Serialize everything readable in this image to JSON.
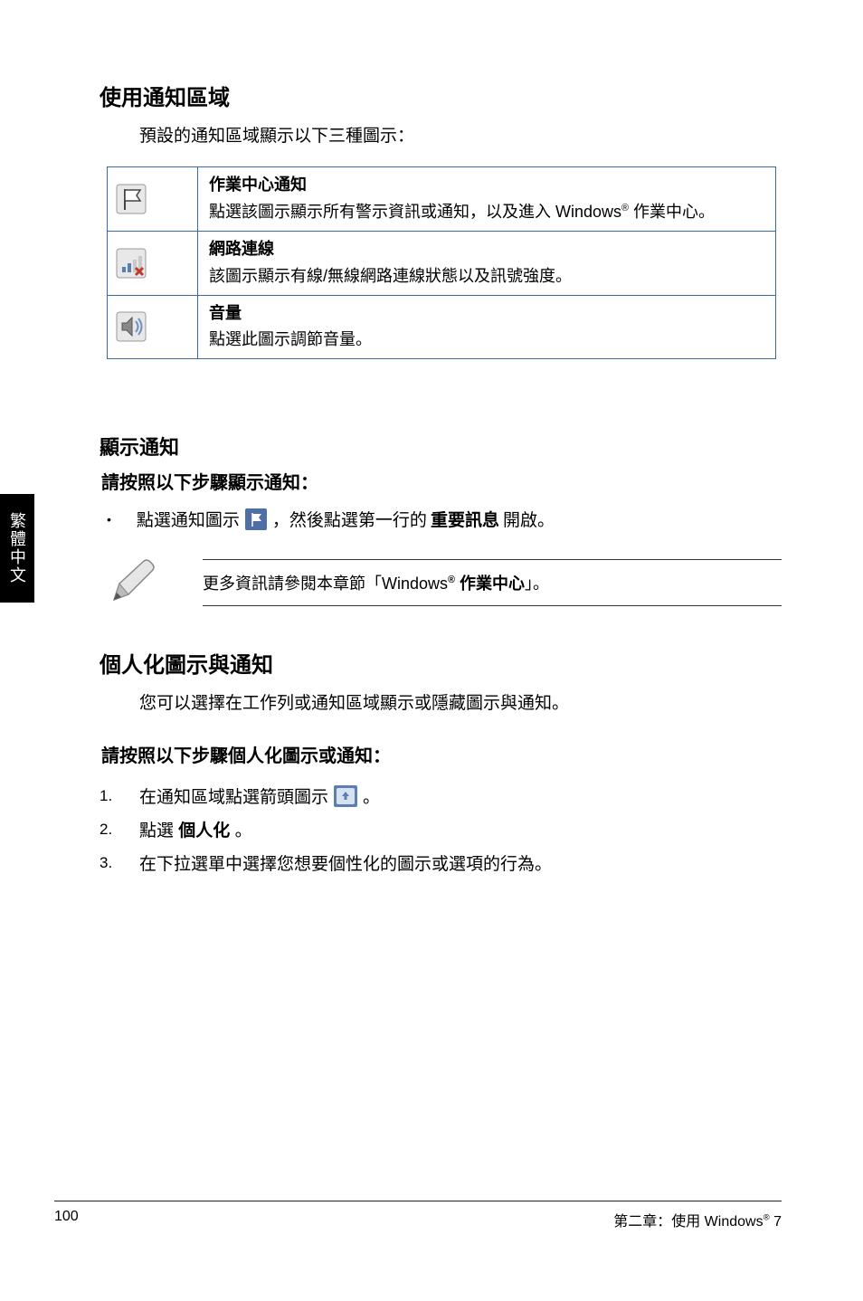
{
  "side_tab": "繁體中文",
  "section1": {
    "title": "使用通知區域",
    "intro": "預設的通知區域顯示以下三種圖示：",
    "rows": [
      {
        "title": "作業中心通知",
        "desc_pre": "點選該圖示顯示所有警示資訊或通知，以及進入 Windows",
        "desc_post": " 作業中心。"
      },
      {
        "title": "網路連線",
        "desc": "該圖示顯示有線/無線網路連線狀態以及訊號強度。"
      },
      {
        "title": "音量",
        "desc": "點選此圖示調節音量。"
      }
    ]
  },
  "section2": {
    "title": "顯示通知",
    "intro": "請按照以下步驟顯示通知：",
    "bullet_pre": "點選通知圖示",
    "bullet_mid": "，然後點選第一行的",
    "bullet_bold": " 重要訊息 ",
    "bullet_end": "開啟。",
    "note_pre": "更多資訊請參閱本章節「Windows",
    "note_bold": " 作業中心",
    "note_end": "」。"
  },
  "section3": {
    "title": "個人化圖示與通知",
    "intro": "您可以選擇在工作列或通知區域顯示或隱藏圖示與通知。",
    "steps_title": "請按照以下步驟個人化圖示或通知：",
    "steps": [
      {
        "n": "1.",
        "pre": "在通知區域點選箭頭圖示",
        "post": "。"
      },
      {
        "n": "2.",
        "pre": "點選 ",
        "bold": "個人化 ",
        "post": "。"
      },
      {
        "n": "3.",
        "text": "在下拉選單中選擇您想要個性化的圖示或選項的行為。"
      }
    ]
  },
  "footer": {
    "page_no": "100",
    "chapter_pre": "第二章：使用 Windows",
    "chapter_post": " 7"
  },
  "registered": "®"
}
